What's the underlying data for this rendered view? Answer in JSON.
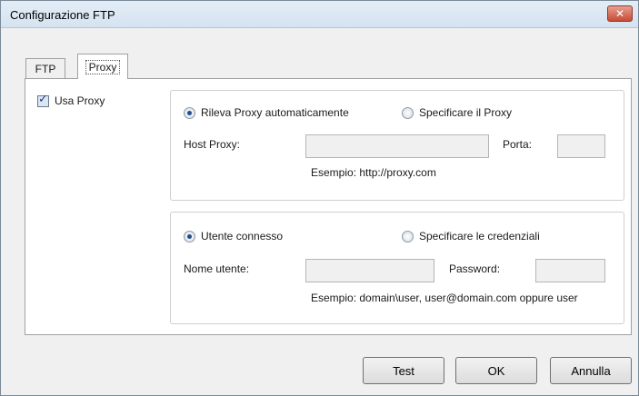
{
  "window": {
    "title": "Configurazione FTP",
    "close_glyph": "✕"
  },
  "tabs": [
    {
      "label": "FTP"
    },
    {
      "label": "Proxy"
    }
  ],
  "use_proxy": {
    "label": "Usa Proxy",
    "checked": true
  },
  "proxy_group": {
    "radio_auto": {
      "label": "Rileva Proxy automaticamente",
      "checked": true
    },
    "radio_manual": {
      "label": "Specificare il Proxy",
      "checked": false
    },
    "host_label": "Host Proxy:",
    "host_value": "",
    "port_label": "Porta:",
    "port_value": "",
    "example": "Esempio: http://proxy.com"
  },
  "credentials_group": {
    "radio_connected": {
      "label": "Utente connesso",
      "checked": true
    },
    "radio_specify": {
      "label": "Specificare le credenziali",
      "checked": false
    },
    "username_label": "Nome utente:",
    "username_value": "",
    "password_label": "Password:",
    "password_value": "",
    "example": "Esempio: domain\\user, user@domain.com oppure user"
  },
  "buttons": {
    "test": "Test",
    "ok": "OK",
    "cancel": "Annulla"
  }
}
